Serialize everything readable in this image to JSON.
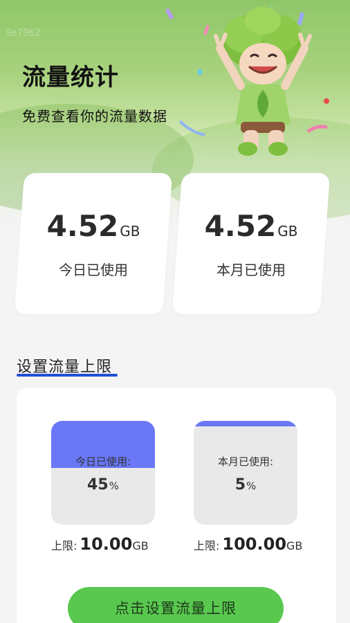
{
  "watermark": "9e7962",
  "header": {
    "title": "流量统计",
    "subtitle": "免费查看你的流量数据"
  },
  "stats": [
    {
      "value": "4.52",
      "unit": "GB",
      "label": "今日已使用"
    },
    {
      "value": "4.52",
      "unit": "GB",
      "label": "本月已使用"
    }
  ],
  "limit_section": {
    "title": "设置流量上限",
    "gauges": [
      {
        "label": "今日已使用:",
        "percent": 45,
        "percent_text": "45",
        "percent_symbol": "%",
        "limit_label": "上限:",
        "limit_value": "10.00",
        "limit_unit": "GB"
      },
      {
        "label": "本月已使用:",
        "percent": 5,
        "percent_text": "5",
        "percent_symbol": "%",
        "limit_label": "上限:",
        "limit_value": "100.00",
        "limit_unit": "GB"
      }
    ],
    "button_label": "点击设置流量上限"
  },
  "colors": {
    "accent_green": "#59c84f",
    "gauge_fill": "#6a78f7",
    "underline_blue": "#1f4fd6"
  },
  "mascot": {
    "icon": "mascot-illustration"
  }
}
